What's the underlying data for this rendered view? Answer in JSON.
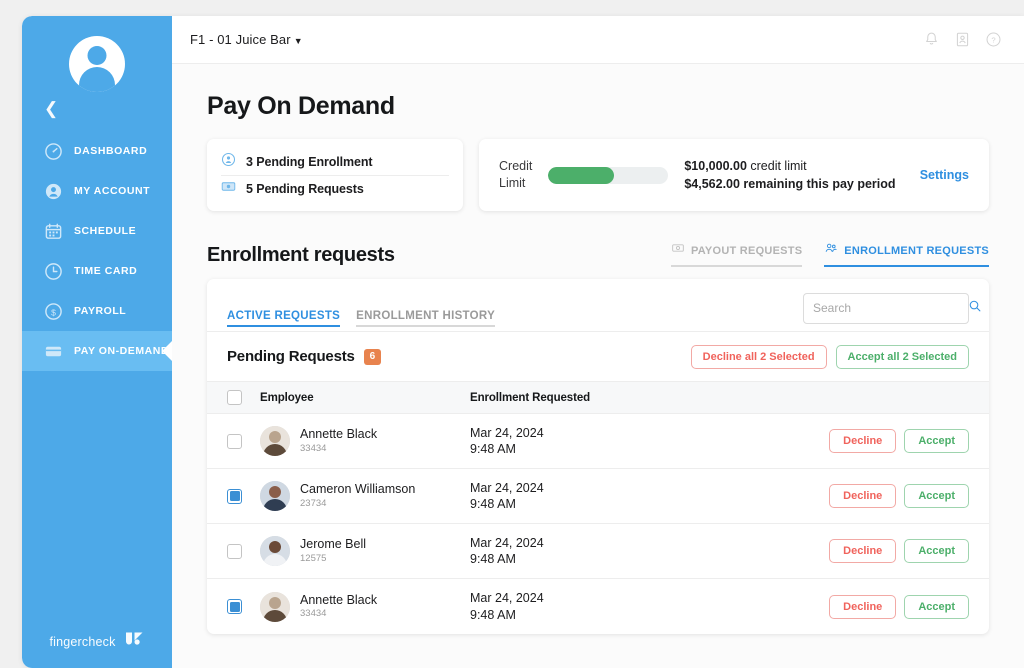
{
  "sidebar": {
    "collapse_icon": "chevron-left-icon",
    "avatar_icon": "user-avatar-icon",
    "items": [
      {
        "label": "DASHBOARD",
        "icon": "speedometer-icon",
        "active": false
      },
      {
        "label": "MY ACCOUNT",
        "icon": "person-circle-icon",
        "active": false
      },
      {
        "label": "SCHEDULE",
        "icon": "calendar-icon",
        "active": false
      },
      {
        "label": "TIME CARD",
        "icon": "clock-icon",
        "active": false
      },
      {
        "label": "PAYROLL",
        "icon": "dollar-circle-icon",
        "active": false
      },
      {
        "label": "PAY ON-DEMAND",
        "icon": "card-icon",
        "active": true
      }
    ],
    "brand_text": "fingercheck",
    "brand_icon": "fingercheck-logo-icon"
  },
  "topbar": {
    "org_name": "F1 - 01 Juice Bar",
    "caret_icon": "chevron-down-icon",
    "icons": [
      {
        "name": "bell-icon"
      },
      {
        "name": "id-card-icon"
      },
      {
        "name": "help-circle-icon"
      }
    ]
  },
  "page": {
    "title": "Pay On Demand"
  },
  "pending_card": {
    "rows": [
      {
        "icon": "person-circle-icon",
        "text": "3 Pending Enrollment"
      },
      {
        "icon": "banknote-icon",
        "text": "5 Pending Requests"
      }
    ]
  },
  "credit_card": {
    "label_line1": "Credit",
    "label_line2": "Limit",
    "progress_percent": 55,
    "progress_color": "#4caf6a",
    "amount": "$10,000.00",
    "amount_suffix": "credit limit",
    "remaining_line": "$4,562.00 remaining this pay period",
    "settings_label": "Settings",
    "settings_color": "#2f8fe0"
  },
  "section": {
    "title": "Enrollment requests",
    "tabs": [
      {
        "label": "PAYOUT REQUESTS",
        "icon": "payout-icon",
        "active": false
      },
      {
        "label": "ENROLLMENT REQUESTS",
        "icon": "enrollment-icon",
        "active": true
      }
    ]
  },
  "panel": {
    "tabs": [
      {
        "label": "ACTIVE REQUESTS",
        "active": true
      },
      {
        "label": "ENROLLMENT HISTORY",
        "active": false
      }
    ],
    "search": {
      "placeholder": "Search",
      "value": "",
      "icon": "search-icon"
    },
    "pending_header": {
      "title": "Pending Requests",
      "count": "6",
      "badge_color": "#e8834e",
      "decline_all_label": "Decline all 2 Selected",
      "accept_all_label": "Accept all 2 Selected"
    },
    "table": {
      "select_all_checked": false,
      "columns": [
        "Employee",
        "Enrollment Requested"
      ],
      "row_actions": {
        "decline": "Decline",
        "accept": "Accept"
      },
      "rows": [
        {
          "checked": false,
          "name": "Annette Black",
          "employee_id": "33434",
          "date": "Mar 24, 2024",
          "time": "9:48 AM",
          "avatar": "photo-annette"
        },
        {
          "checked": true,
          "name": "Cameron Williamson",
          "employee_id": "23734",
          "date": "Mar 24, 2024",
          "time": "9:48 AM",
          "avatar": "photo-cameron"
        },
        {
          "checked": false,
          "name": "Jerome Bell",
          "employee_id": "12575",
          "date": "Mar 24, 2024",
          "time": "9:48 AM",
          "avatar": "photo-jerome"
        },
        {
          "checked": true,
          "name": "Annette Black",
          "employee_id": "33434",
          "date": "Mar 24, 2024",
          "time": "9:48 AM",
          "avatar": "photo-annette"
        }
      ]
    }
  }
}
